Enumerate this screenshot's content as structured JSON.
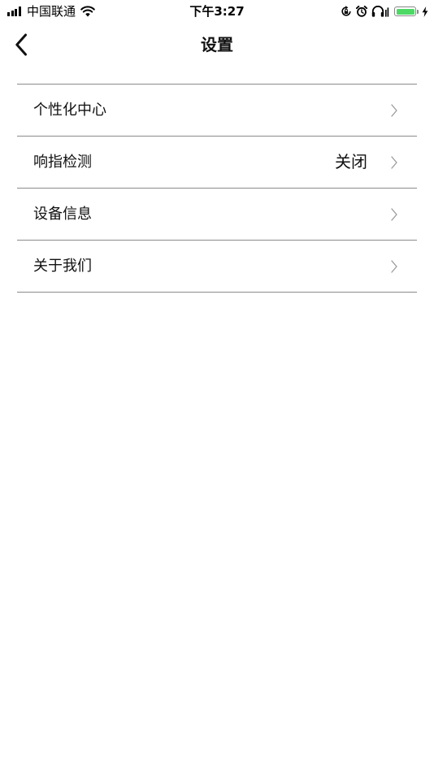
{
  "status_bar": {
    "carrier": "中国联通",
    "time": "下午3:27",
    "battery_color": "#4cd964",
    "icons": [
      "signal-icon",
      "wifi-icon",
      "rotation-lock-icon",
      "alarm-icon",
      "headphones-icon",
      "battery-icon",
      "charging-icon"
    ]
  },
  "nav": {
    "title": "设置",
    "back_icon": "chevron-left-icon"
  },
  "settings": {
    "items": [
      {
        "label": "个性化中心",
        "value": ""
      },
      {
        "label": "响指检测",
        "value": "关闭"
      },
      {
        "label": "设备信息",
        "value": ""
      },
      {
        "label": "关于我们",
        "value": ""
      }
    ],
    "divider_color": "#8a8a8a",
    "chevron_color": "#9a9a9a"
  }
}
